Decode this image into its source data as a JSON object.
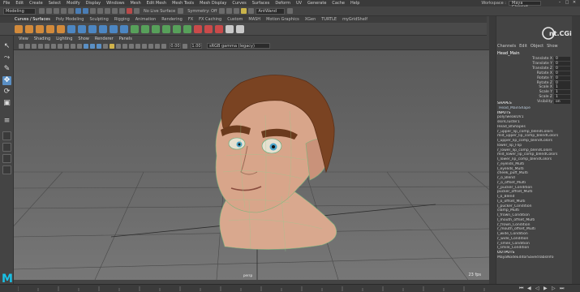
{
  "menubar": {
    "items": [
      "File",
      "Edit",
      "Create",
      "Select",
      "Modify",
      "Display",
      "Windows",
      "Mesh",
      "Edit Mesh",
      "Mesh Tools",
      "Mesh Display",
      "Curves",
      "Surfaces",
      "Deform",
      "UV",
      "Generate",
      "Cache",
      "Help"
    ],
    "workspace_label": "Workspace :",
    "workspace_value": "Maya Classic*"
  },
  "statusline": {
    "mode": "Modeling",
    "live_surface": "No Live Surface",
    "symmetry": "Symmetry: Off",
    "layout": "AntWand"
  },
  "shelf": {
    "tabs": [
      "Curves / Surfaces",
      "Poly Modeling",
      "Sculpting",
      "Rigging",
      "Animation",
      "Rendering",
      "FX",
      "FX Caching",
      "Custom",
      "MASH",
      "Motion Graphics",
      "XGen",
      "TURTLE",
      "myGridShelf"
    ]
  },
  "viewport": {
    "menu": [
      "View",
      "Shading",
      "Lighting",
      "Show",
      "Renderer",
      "Panels"
    ],
    "near": "0.00",
    "far": "1.00",
    "colorspace": "sRGB gamma (legacy)",
    "camera": "persp",
    "fps": "23 fps"
  },
  "channelbox": {
    "tabs": [
      "Channels",
      "Edit",
      "Object",
      "Show"
    ],
    "object": "Head_Main",
    "attributes": [
      {
        "name": "Translate X",
        "value": "0"
      },
      {
        "name": "Translate Y",
        "value": "0"
      },
      {
        "name": "Translate Z",
        "value": "0"
      },
      {
        "name": "Rotate X",
        "value": "0"
      },
      {
        "name": "Rotate Y",
        "value": "0"
      },
      {
        "name": "Rotate Z",
        "value": "0"
      },
      {
        "name": "Scale X",
        "value": "1"
      },
      {
        "name": "Scale Y",
        "value": "1"
      },
      {
        "name": "Scale Z",
        "value": "1"
      },
      {
        "name": "Visibility",
        "value": "on"
      }
    ],
    "history": [
      {
        "text": "SHAPES",
        "kind": "hd"
      },
      {
        "text": "Head_MainShape",
        "kind": "ind"
      },
      {
        "text": "INPUTS",
        "kind": "hd"
      },
      {
        "text": "polyTweakUV1",
        "kind": ""
      },
      {
        "text": "skinCluster1",
        "kind": ""
      },
      {
        "text": "Head_BlShapes",
        "kind": ""
      },
      {
        "text": "r_upper_lip_comp_blendColors",
        "kind": ""
      },
      {
        "text": "mid_upper_lip_comp_blendColors",
        "kind": ""
      },
      {
        "text": "l_upper_lip_comp_blendColors",
        "kind": ""
      },
      {
        "text": "lower_lip_Flip",
        "kind": ""
      },
      {
        "text": "r_lower_lip_comp_blendColors",
        "kind": ""
      },
      {
        "text": "mid_lower_lip_comp_blendColors",
        "kind": ""
      },
      {
        "text": "l_lower_lip_comp_blendColors",
        "kind": ""
      },
      {
        "text": "r_eyelids_Multi",
        "kind": ""
      },
      {
        "text": "l_eyelids_Multi",
        "kind": ""
      },
      {
        "text": "cheek_puff_Multi",
        "kind": ""
      },
      {
        "text": "r_o_Blend",
        "kind": ""
      },
      {
        "text": "r_o_offset_Multi",
        "kind": ""
      },
      {
        "text": "r_pucker_Condition",
        "kind": ""
      },
      {
        "text": "pucker_offset_Multi",
        "kind": ""
      },
      {
        "text": "l_o_Blend",
        "kind": ""
      },
      {
        "text": "l_o_offset_Multi",
        "kind": ""
      },
      {
        "text": "l_pucker_Condition",
        "kind": ""
      },
      {
        "text": "clamp_Multi",
        "kind": ""
      },
      {
        "text": "l_frown_Condition",
        "kind": ""
      },
      {
        "text": "l_mouth_offset_Multi",
        "kind": ""
      },
      {
        "text": "r_frown_Condition",
        "kind": ""
      },
      {
        "text": "r_mouth_offset_Multi",
        "kind": ""
      },
      {
        "text": "l_wide_Condition",
        "kind": ""
      },
      {
        "text": "r_wide_Condition",
        "kind": ""
      },
      {
        "text": "r_smile_Condition",
        "kind": ""
      },
      {
        "text": "l_smile_Condition",
        "kind": ""
      },
      {
        "text": "OUTPUTS",
        "kind": "hd"
      },
      {
        "text": "MayaNodeEditorSavedTabsInfo",
        "kind": ""
      }
    ]
  },
  "branding": {
    "logo_text": "Ant.CGi",
    "app_logo": "M"
  }
}
